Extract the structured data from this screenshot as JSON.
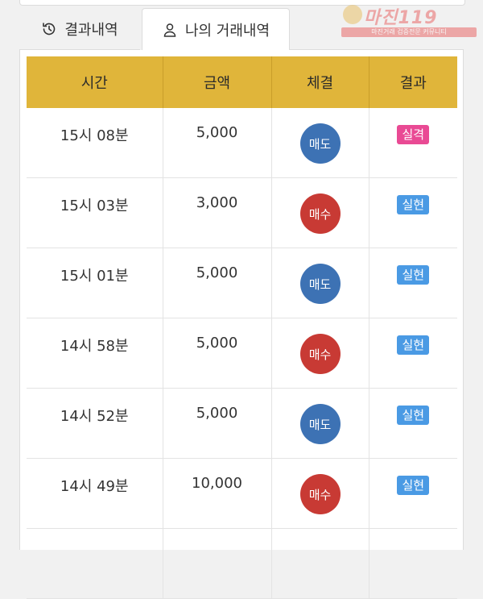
{
  "tabs": {
    "results_label": "결과내역",
    "my_trades_label": "나의 거래내역"
  },
  "watermark": {
    "brand": "마진",
    "suffix": "119",
    "tagline": "마진거래 검증전문 커뮤니티"
  },
  "table": {
    "headers": [
      "시간",
      "금액",
      "체결",
      "결과"
    ],
    "rows": [
      {
        "time": "15시 08분",
        "amount": "5,000",
        "side": "매도",
        "result": "실격"
      },
      {
        "time": "15시 03분",
        "amount": "3,000",
        "side": "매수",
        "result": "실현"
      },
      {
        "time": "15시 01분",
        "amount": "5,000",
        "side": "매도",
        "result": "실현"
      },
      {
        "time": "14시 58분",
        "amount": "5,000",
        "side": "매수",
        "result": "실현"
      },
      {
        "time": "14시 52분",
        "amount": "5,000",
        "side": "매도",
        "result": "실현"
      },
      {
        "time": "14시 49분",
        "amount": "10,000",
        "side": "매수",
        "result": "실현"
      }
    ]
  },
  "colors": {
    "header_bg": "#e0b53a",
    "sell": "#3d72b4",
    "buy": "#c83a34",
    "result_fail": "#e94a94",
    "result_ok": "#4a9ae4"
  }
}
